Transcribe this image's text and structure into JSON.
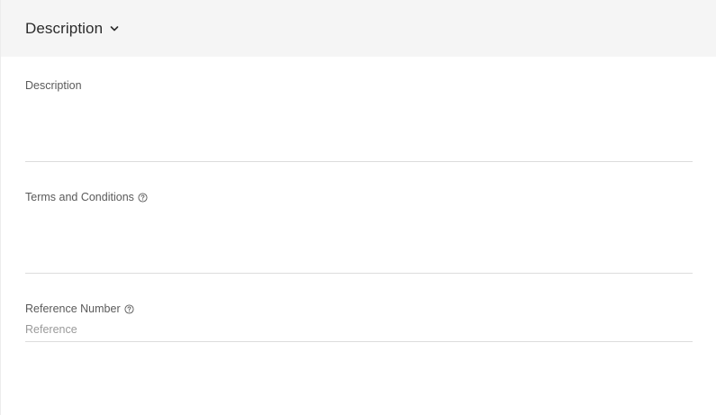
{
  "section": {
    "title": "Description",
    "toggle_icon": "chevron-down-icon"
  },
  "fields": {
    "description": {
      "label": "Description",
      "value": ""
    },
    "terms": {
      "label": "Terms and Conditions",
      "help_icon": "help-circle-icon",
      "value": ""
    },
    "reference": {
      "label": "Reference Number",
      "help_icon": "help-circle-icon",
      "placeholder": "Reference",
      "value": ""
    }
  }
}
